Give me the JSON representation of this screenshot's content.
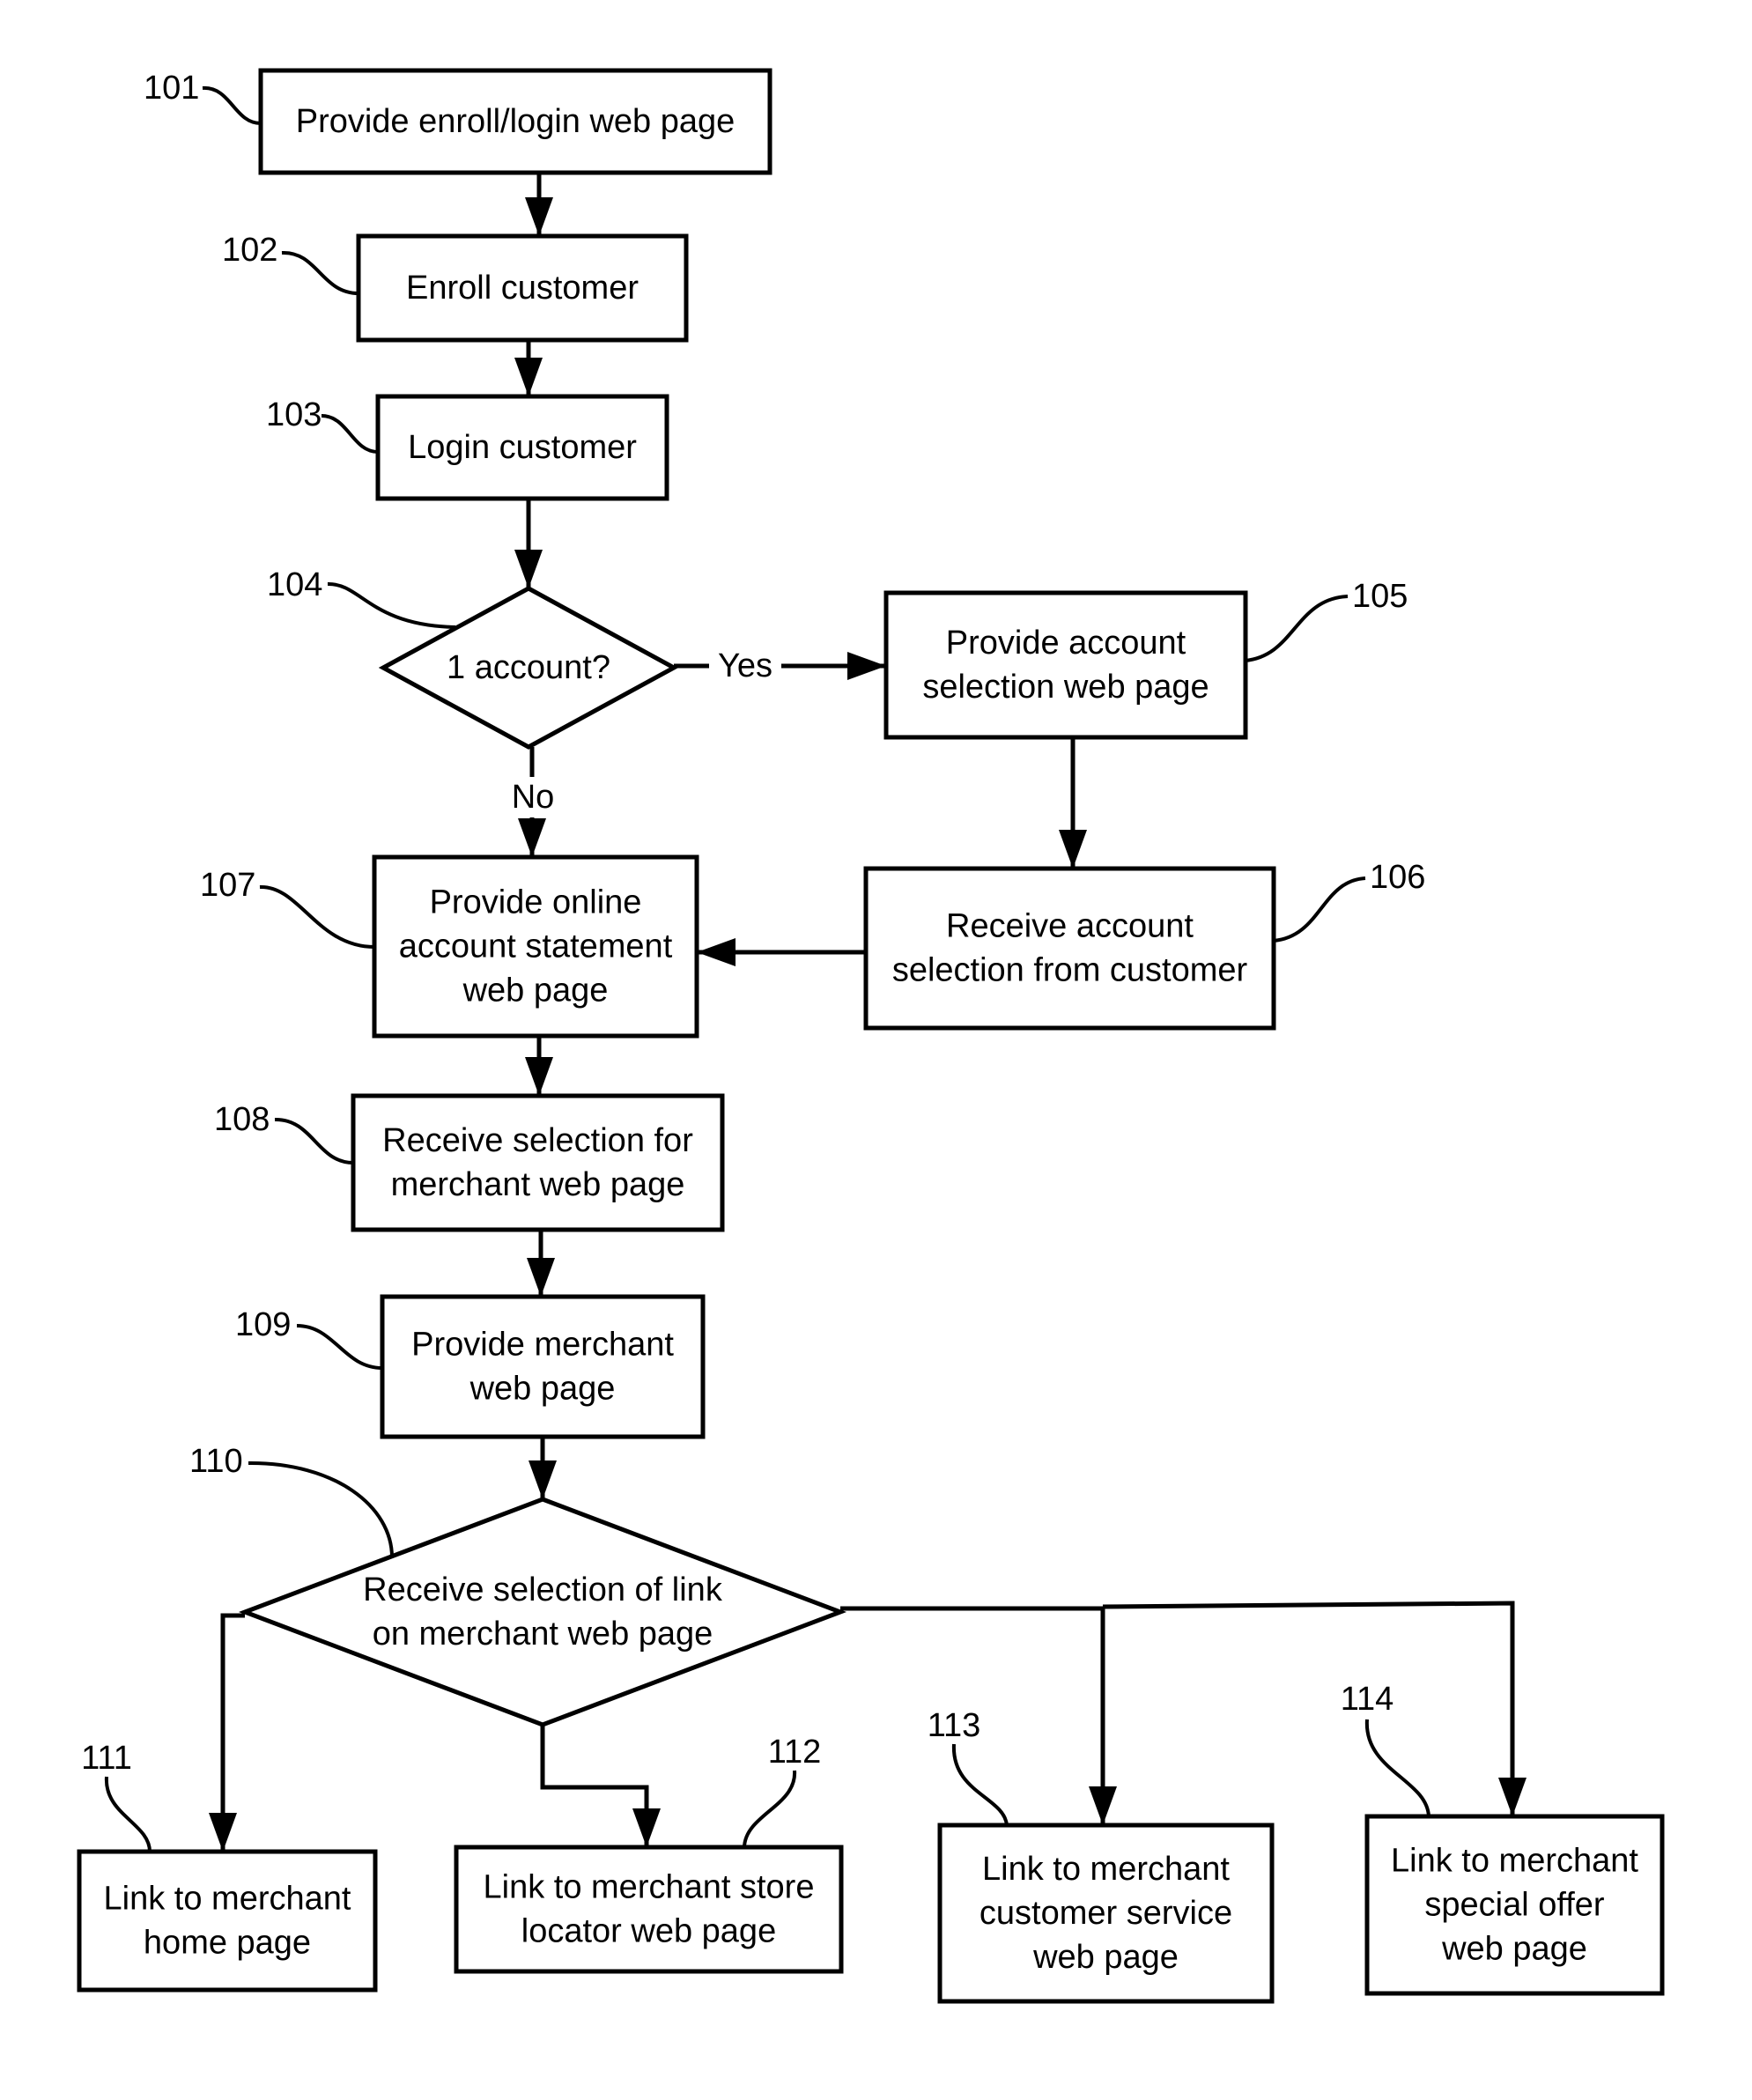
{
  "diagram": {
    "type": "flowchart",
    "nodes": [
      {
        "id": "101",
        "shape": "process",
        "ref": "101",
        "lines": [
          "Provide enroll/login web page"
        ]
      },
      {
        "id": "102",
        "shape": "process",
        "ref": "102",
        "lines": [
          "Enroll customer"
        ]
      },
      {
        "id": "103",
        "shape": "process",
        "ref": "103",
        "lines": [
          "Login customer"
        ]
      },
      {
        "id": "104",
        "shape": "decision",
        "ref": "104",
        "lines": [
          "1 account?"
        ]
      },
      {
        "id": "105",
        "shape": "process",
        "ref": "105",
        "lines": [
          "Provide account",
          "selection web page"
        ]
      },
      {
        "id": "106",
        "shape": "process",
        "ref": "106",
        "lines": [
          "Receive account",
          "selection from customer"
        ]
      },
      {
        "id": "107",
        "shape": "process",
        "ref": "107",
        "lines": [
          "Provide online",
          "account statement",
          "web page"
        ]
      },
      {
        "id": "108",
        "shape": "process",
        "ref": "108",
        "lines": [
          "Receive selection for",
          "merchant web page"
        ]
      },
      {
        "id": "109",
        "shape": "process",
        "ref": "109",
        "lines": [
          "Provide merchant",
          "web page"
        ]
      },
      {
        "id": "110",
        "shape": "decision",
        "ref": "110",
        "lines": [
          "Receive selection of link",
          "on merchant web page"
        ]
      },
      {
        "id": "111",
        "shape": "process",
        "ref": "111",
        "lines": [
          "Link to merchant",
          "home page"
        ]
      },
      {
        "id": "112",
        "shape": "process",
        "ref": "112",
        "lines": [
          "Link to merchant store",
          "locator web page"
        ]
      },
      {
        "id": "113",
        "shape": "process",
        "ref": "113",
        "lines": [
          "Link to merchant",
          "customer service",
          "web page"
        ]
      },
      {
        "id": "114",
        "shape": "process",
        "ref": "114",
        "lines": [
          "Link to merchant",
          "special offer",
          "web page"
        ]
      }
    ],
    "edges": [
      {
        "from": "101",
        "to": "102",
        "label": ""
      },
      {
        "from": "102",
        "to": "103",
        "label": ""
      },
      {
        "from": "103",
        "to": "104",
        "label": ""
      },
      {
        "from": "104",
        "to": "105",
        "label": "Yes"
      },
      {
        "from": "104",
        "to": "107",
        "label": "No"
      },
      {
        "from": "105",
        "to": "106",
        "label": ""
      },
      {
        "from": "106",
        "to": "107",
        "label": ""
      },
      {
        "from": "107",
        "to": "108",
        "label": ""
      },
      {
        "from": "108",
        "to": "109",
        "label": ""
      },
      {
        "from": "109",
        "to": "110",
        "label": ""
      },
      {
        "from": "110",
        "to": "111",
        "label": ""
      },
      {
        "from": "110",
        "to": "112",
        "label": ""
      },
      {
        "from": "110",
        "to": "113",
        "label": ""
      },
      {
        "from": "110",
        "to": "114",
        "label": ""
      }
    ]
  }
}
